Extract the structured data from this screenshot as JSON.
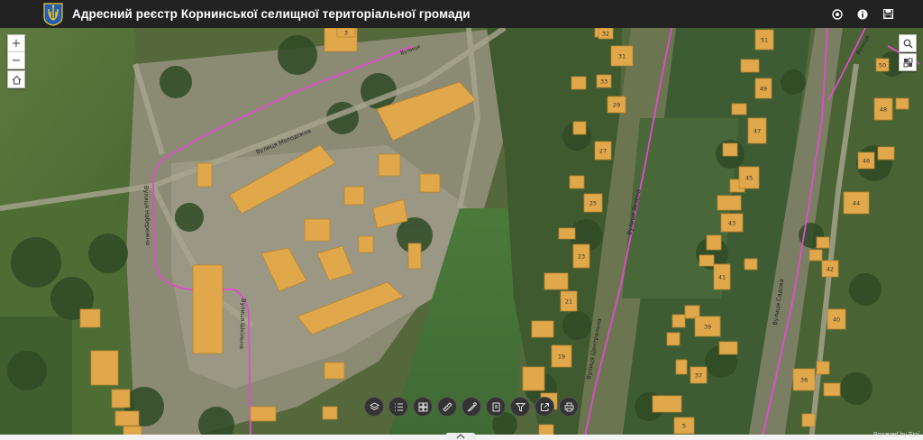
{
  "header": {
    "title": "Адресний реєстр Корнинської селищної територіальної громади",
    "icons": [
      "emblem-icon",
      "eye-icon",
      "info-icon",
      "save-icon"
    ]
  },
  "map_controls": {
    "zoom_in": "+",
    "zoom_out": "−",
    "icons": [
      "home-icon",
      "search-icon",
      "basemap-gallery-icon"
    ]
  },
  "toolbar": {
    "icons": [
      "layers-icon",
      "legend-icon",
      "gallery-icon",
      "measure-icon",
      "draw-icon",
      "bookmark-icon",
      "filter-icon",
      "share-icon",
      "print-icon"
    ]
  },
  "streets": {
    "s1": "Вулиця Молодіжна",
    "s2": "Вулиця Набережна",
    "s3": "Вулиця Шкільна",
    "s4": "Вулиця Зелена",
    "s5": "Вулиця Центральна",
    "s6": "Вулиця Садова"
  },
  "house_numbers": [
    "31",
    "33",
    "32",
    "29",
    "27",
    "25",
    "23",
    "21",
    "19",
    "51",
    "49",
    "47",
    "45",
    "43",
    "41",
    "39",
    "37",
    "5",
    "50",
    "48",
    "46",
    "44",
    "42",
    "40",
    "38",
    "3"
  ],
  "attribution": "Powered by Esri"
}
